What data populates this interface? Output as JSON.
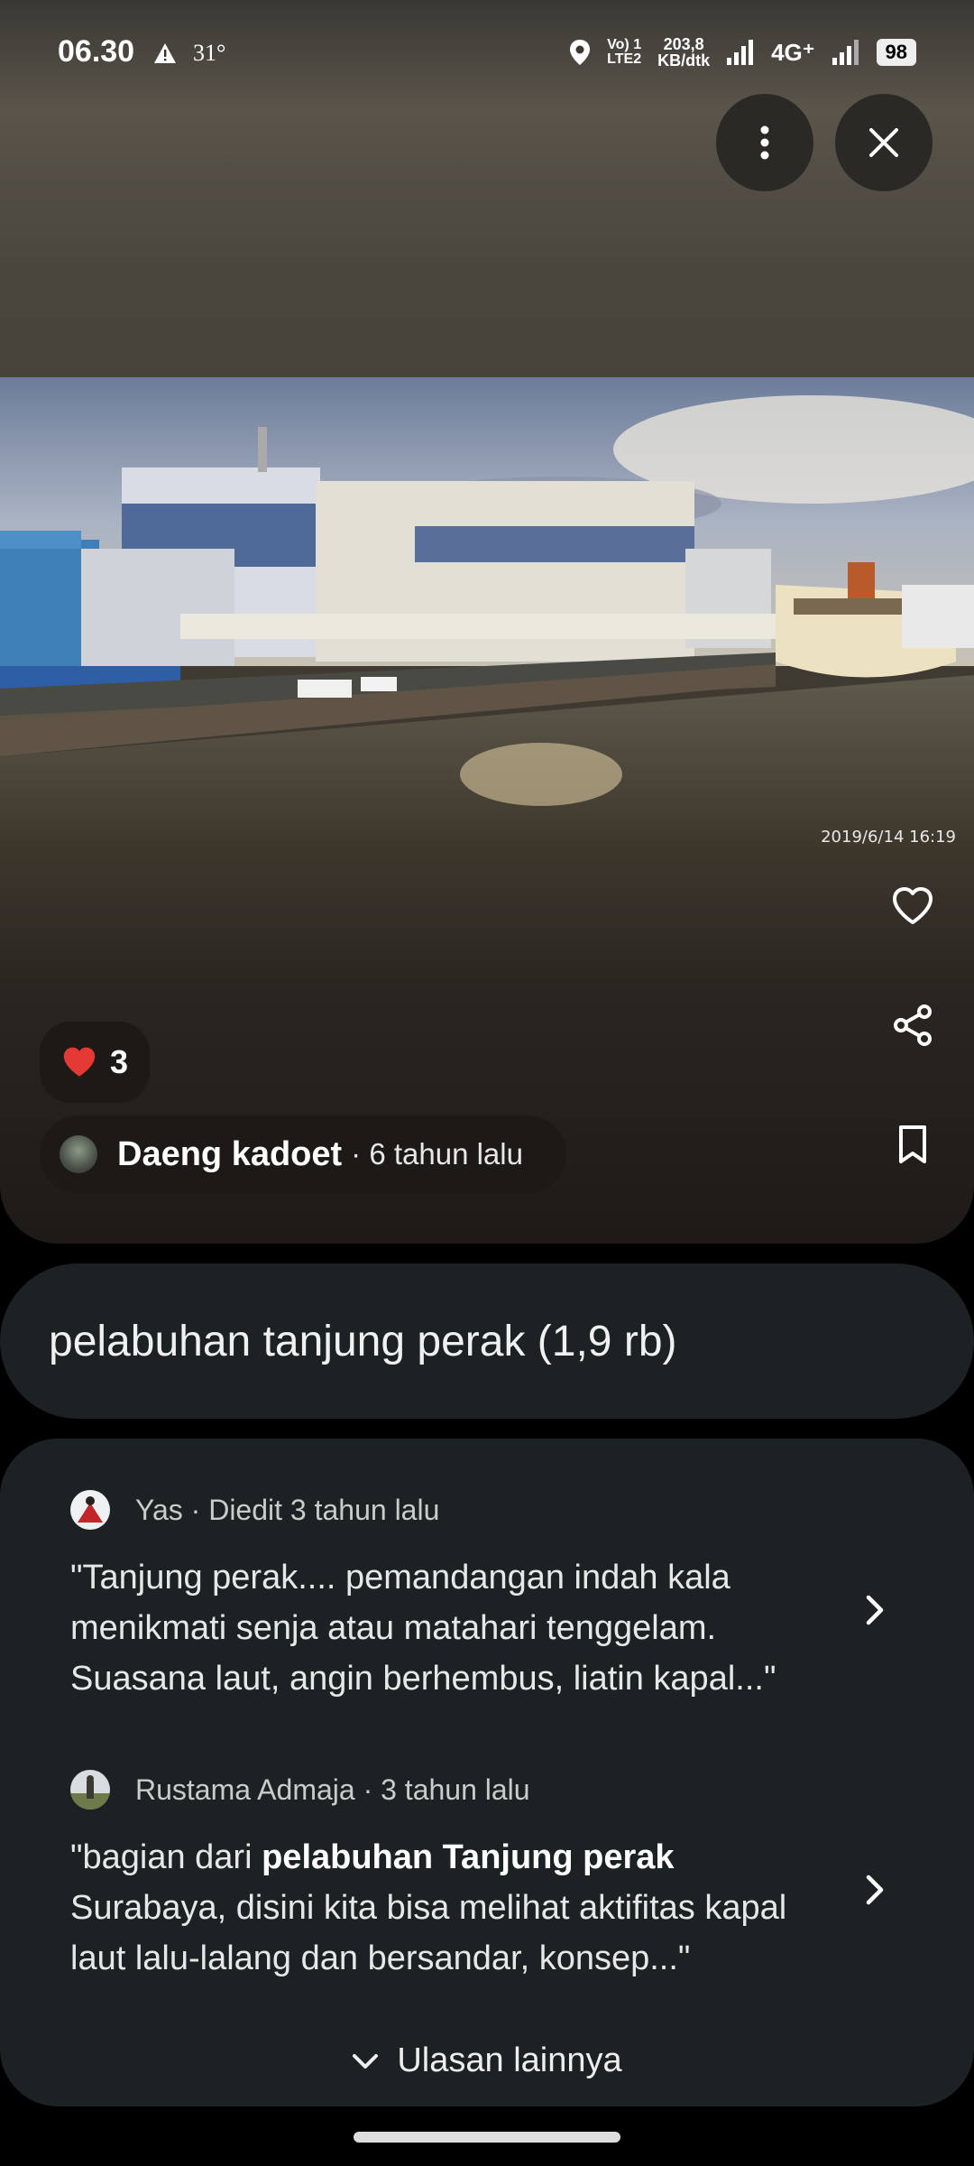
{
  "status_bar": {
    "time": "06.30",
    "temperature": "31°",
    "volte_top": "Vo) 1",
    "volte_bottom": "LTE2",
    "speed_value": "203,8",
    "speed_unit": "KB/dtk",
    "network": "4G⁺",
    "battery": "98"
  },
  "viewer": {
    "photo_timestamp": "2019/6/14  16:19",
    "likes": "3",
    "author_name": "Daeng kadoet",
    "author_meta": "· 6 tahun lalu",
    "icons": [
      "more-vert-icon",
      "close-icon",
      "heart-outline-icon",
      "share-icon",
      "bookmark-icon"
    ]
  },
  "place": {
    "title": "pelabuhan tanjung perak (1,9 rb)"
  },
  "reviews": [
    {
      "author": "Yas · Diedit 3 tahun lalu",
      "text": "\"Tanjung perak.... pemandangan indah kala menikmati senja atau matahari tenggelam. Suasana laut, angin berhembus, liatin kapal...\""
    },
    {
      "author": "Rustama Admaja · 3 tahun lalu",
      "text_before": "\"bagian dari ",
      "text_bold": "pelabuhan Tanjung perak",
      "text_after": " Surabaya, disini kita bisa melihat aktifitas kapal laut lalu-lalang dan bersandar, konsep...\""
    }
  ],
  "more_reviews_label": "Ulasan lainnya"
}
